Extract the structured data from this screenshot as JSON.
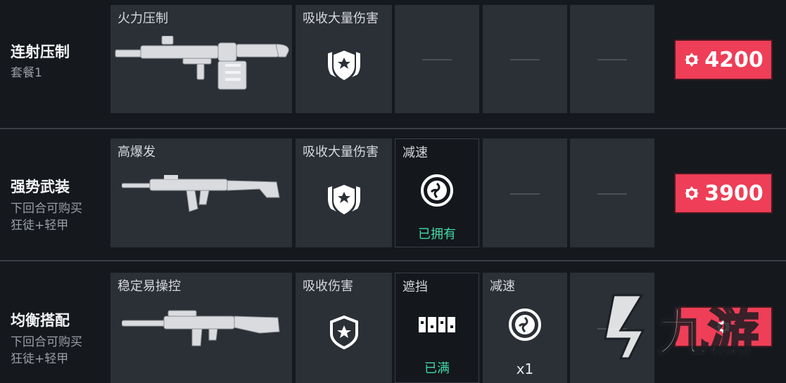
{
  "colors": {
    "accent": "#ef3e57",
    "owned_green": "#3fd9a5",
    "panel": "#2b2f36",
    "background": "#15181d"
  },
  "rows": [
    {
      "name": "连射压制",
      "subtitle": "套餐1",
      "weapon": {
        "label": "火力压制",
        "icon": "machine-gun-icon"
      },
      "armor": {
        "label": "吸收大量伤害",
        "icon": "heavy-shield-icon"
      },
      "price": "4200"
    },
    {
      "name": "强势武装",
      "subtitle_line1": "下回合可购买",
      "subtitle_line2": "狂徒+轻甲",
      "weapon": {
        "label": "高爆发",
        "icon": "assault-rifle-icon"
      },
      "armor": {
        "label": "吸收大量伤害",
        "icon": "heavy-shield-icon"
      },
      "ability": {
        "label": "减速",
        "icon": "slow-orb-icon",
        "status": "已拥有"
      },
      "price": "3900"
    },
    {
      "name": "均衡搭配",
      "subtitle_line1": "下回合可购买",
      "subtitle_line2": "狂徒+轻甲",
      "weapon": {
        "label": "稳定易操控",
        "icon": "rifle-icon"
      },
      "armor": {
        "label": "吸收伤害",
        "icon": "light-shield-icon"
      },
      "ability": {
        "label": "遮挡",
        "icon": "wall-icon",
        "status": "已满"
      },
      "ability2": {
        "label": "减速",
        "icon": "slow-orb-icon",
        "count": "x1"
      }
    }
  ],
  "watermark": {
    "text": "九游"
  }
}
